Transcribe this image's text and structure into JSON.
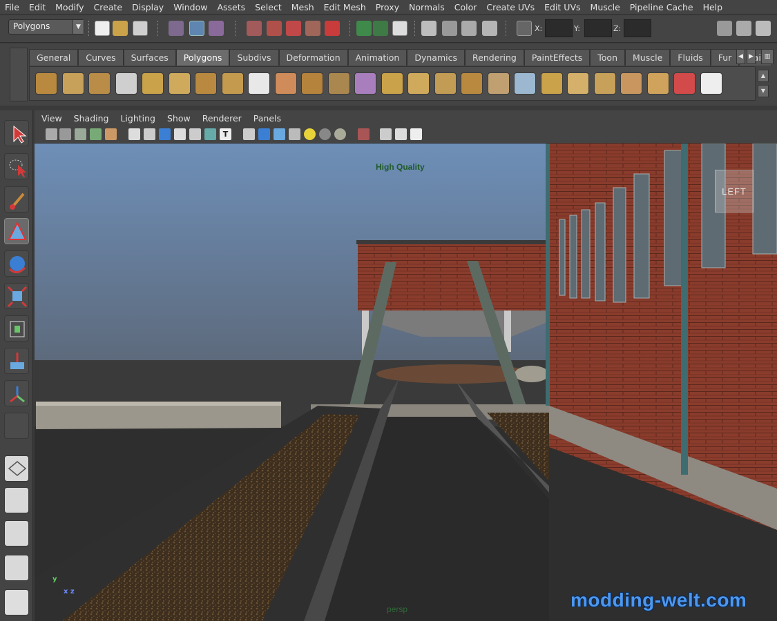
{
  "menu": [
    "File",
    "Edit",
    "Modify",
    "Create",
    "Display",
    "Window",
    "Assets",
    "Select",
    "Mesh",
    "Edit Mesh",
    "Proxy",
    "Normals",
    "Color",
    "Create UVs",
    "Edit UVs",
    "Muscle",
    "Pipeline Cache",
    "Help"
  ],
  "status_line": {
    "mode": "Polygons",
    "coord_labels": [
      "X:",
      "Y:",
      "Z:"
    ]
  },
  "shelf": {
    "tabs": [
      "General",
      "Curves",
      "Surfaces",
      "Polygons",
      "Subdivs",
      "Deformation",
      "Animation",
      "Dynamics",
      "Rendering",
      "PaintEffects",
      "Toon",
      "Muscle",
      "Fluids",
      "Fur",
      "Hair"
    ],
    "active_tab": "Polygons",
    "icons": [
      "poly-sphere-icon",
      "poly-cube-icon",
      "poly-cylinder-icon",
      "poly-cone-icon",
      "poly-plane-icon",
      "poly-torus-icon",
      "poly-pyramid-icon",
      "poly-pipe-icon",
      "soccer-ball-icon",
      "combine-icon",
      "separate-icon",
      "extract-icon",
      "smooth-icon",
      "booleans-icon",
      "mirror-icon",
      "extrude-icon",
      "bridge-icon",
      "append-icon",
      "split-icon",
      "bevel-icon",
      "wedge-icon",
      "duplicate-face-icon",
      "merge-icon",
      "collapse-icon",
      "uv-editor-icon",
      "checker-icon"
    ]
  },
  "panel": {
    "menu": [
      "View",
      "Shading",
      "Lighting",
      "Show",
      "Renderer",
      "Panels"
    ]
  },
  "viewport": {
    "hud_quality": "High Quality",
    "hud_camera": "persp",
    "viewcube_label": "LEFT",
    "axis_y": "y",
    "axis_x": "x z",
    "watermark": "modding-welt.com"
  },
  "colors": {
    "accent": "#4d97ee",
    "ui_bg": "#444444",
    "sky_top": "#6e8fb8",
    "sky_bottom": "#5d6a7c",
    "brick": "#8a3c2c"
  }
}
